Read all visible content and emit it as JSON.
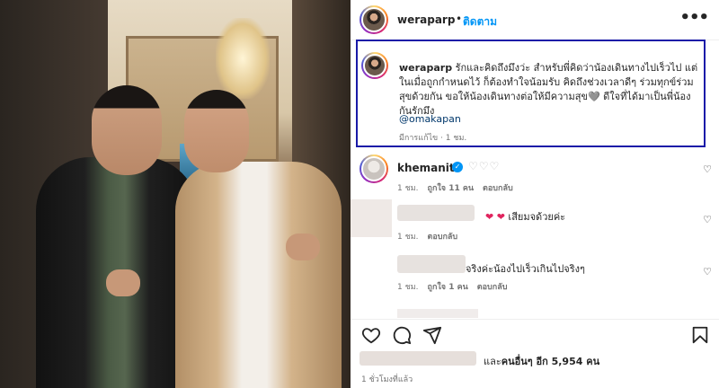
{
  "post": {
    "username": "weraparp",
    "separator": "•",
    "follow_label": "ติดตาม",
    "more_label": "•••"
  },
  "caption": {
    "username": "weraparp",
    "text": "รักและคิดถึงมึงว่ะ สำหรับพี่คิดว่าน้องเดินทางไปเร็วไป แต่ในเมื่อถูกกำหนดไว้ ก็ต้องทำใจน้อมรับ คิดถึงช่วงเวลาดีๆ ร่วมทุกข์ร่วมสุขด้วยกัน ขอให้น้องเดินทางต่อให้มีความสุข🩶 ดีใจที่ได้มาเป็นพี่น้องกันรักมึง",
    "mention": "@omakapan",
    "meta": "มีการแก้ไข · 1 ชม."
  },
  "comments": [
    {
      "username": "khemanito",
      "verified_mark": "✓",
      "text": "♡♡♡",
      "time": "1 ชม.",
      "likes": "ถูกใจ 11 คน",
      "reply": "ตอบกลับ"
    },
    {
      "text_hearts": "❤ ❤",
      "text": " เสียมจด้วยค่ะ",
      "time": "1 ชม.",
      "reply": "ตอบกลับ"
    },
    {
      "text": "จริงค่ะน้องไปเร็วเกินไปจริงๆ",
      "time": "1 ชม.",
      "likes": "ถูกใจ 1 คน",
      "reply": "ตอบกลับ"
    }
  ],
  "likes_summary": {
    "prefix": "และ",
    "bold": "คนอื่นๆ อีก 5,954 คน"
  },
  "timestamp": "1 ชั่วโมงที่แล้ว",
  "icons": {
    "heart": "heart-icon",
    "comment": "comment-icon",
    "share": "share-icon",
    "save": "bookmark-icon"
  },
  "colors": {
    "accent": "#0095f6",
    "highlight_border": "#1a1aa8",
    "text": "#262626",
    "muted": "#737373"
  }
}
